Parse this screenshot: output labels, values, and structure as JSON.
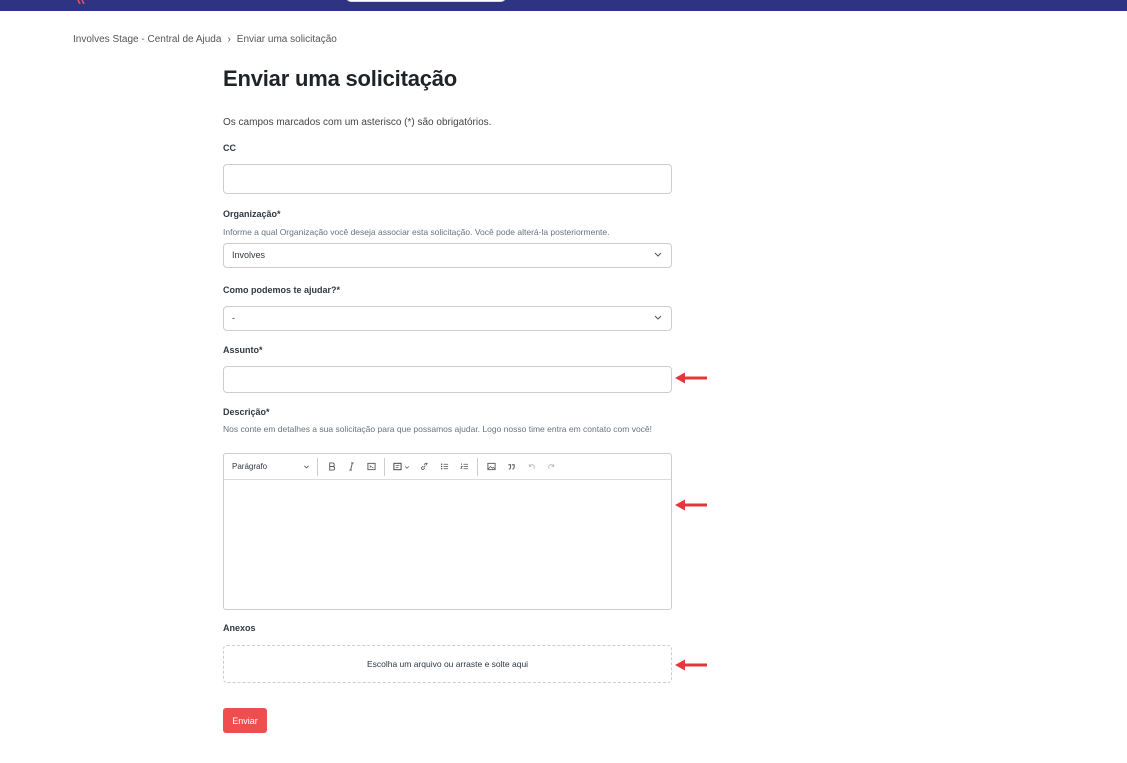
{
  "colors": {
    "topbar": "#2f3482",
    "accent": "#f04e4e",
    "arrow": "#e0383b"
  },
  "breadcrumb": {
    "items": [
      "Involves Stage - Central de Ajuda",
      "Enviar uma solicitação"
    ],
    "separator": "›"
  },
  "page": {
    "title": "Enviar uma solicitação",
    "required_note": "Os campos marcados com um asterisco (*) são obrigatórios."
  },
  "form": {
    "cc": {
      "label": "CC",
      "value": ""
    },
    "organization": {
      "label": "Organização*",
      "hint": "Informe a qual Organização você deseja associar esta solicitação. Você pode alterá-la posteriormente.",
      "selected": "Involves"
    },
    "help_type": {
      "label": "Como podemos te ajudar?*",
      "selected": "-"
    },
    "subject": {
      "label": "Assunto*",
      "value": ""
    },
    "description": {
      "label": "Descrição*",
      "hint": "Nos conte em detalhes a sua solicitação para que possamos ajudar. Logo nosso time entra em contato com você!",
      "value": "",
      "toolbar": {
        "format_label": "Parágrafo",
        "icons": [
          "bold-icon",
          "italic-icon",
          "code-icon",
          "code-block-icon",
          "link-icon",
          "bulleted-list-icon",
          "numbered-list-icon",
          "image-icon",
          "quote-icon",
          "undo-icon",
          "redo-icon"
        ]
      }
    },
    "attachments": {
      "label": "Anexos",
      "dropzone_text": "Escolha um arquivo ou arraste e solte aqui"
    },
    "submit_label": "Enviar"
  }
}
